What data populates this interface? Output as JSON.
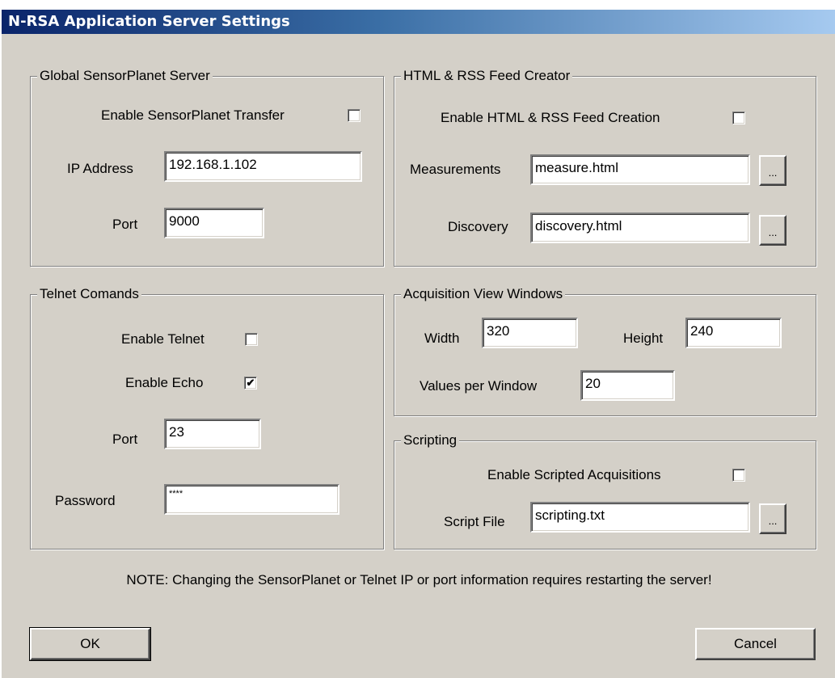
{
  "window": {
    "title": "N-RSA Application Server Settings"
  },
  "global_server": {
    "legend": "Global SensorPlanet Server",
    "enable_label": "Enable SensorPlanet Transfer",
    "enable_checked": "",
    "ip_label": "IP Address",
    "ip_value": "192.168.1.102",
    "port_label": "Port",
    "port_value": "9000"
  },
  "html_rss": {
    "legend": "HTML & RSS Feed Creator",
    "enable_label": "Enable HTML & RSS Feed Creation",
    "enable_checked": "",
    "measurements_label": "Measurements",
    "measurements_value": "measure.html",
    "discovery_label": "Discovery",
    "discovery_value": "discovery.html",
    "browse_label": "..."
  },
  "telnet": {
    "legend": "Telnet Comands",
    "enable_telnet_label": "Enable Telnet",
    "enable_telnet_checked": "",
    "enable_echo_label": "Enable Echo",
    "enable_echo_checked": "✔",
    "port_label": "Port",
    "port_value": "23",
    "password_label": "Password",
    "password_value": "****"
  },
  "acquisition": {
    "legend": "Acquisition View Windows",
    "width_label": "Width",
    "width_value": "320",
    "height_label": "Height",
    "height_value": "240",
    "values_label": "Values per Window",
    "values_value": "20"
  },
  "scripting": {
    "legend": "Scripting",
    "enable_label": "Enable Scripted Acquisitions",
    "enable_checked": "",
    "file_label": "Script File",
    "file_value": "scripting.txt",
    "browse_label": "..."
  },
  "note": "NOTE: Changing the SensorPlanet or Telnet IP or port information requires restarting the server!",
  "buttons": {
    "ok": "OK",
    "cancel": "Cancel"
  }
}
